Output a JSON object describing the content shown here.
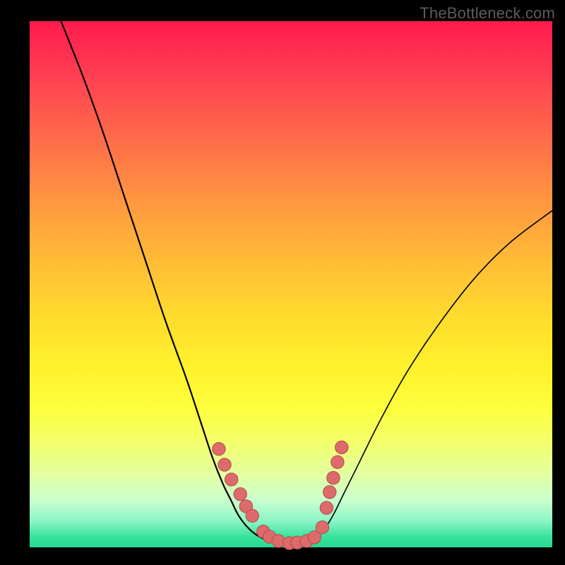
{
  "watermark": "TheBottleneck.com",
  "colors": {
    "frame": "#000000",
    "curve": "#000000",
    "dot_fill": "#dd6b6b",
    "dot_stroke": "#b44a4a",
    "gradient_top": "#ff1a4d",
    "gradient_bottom": "#28d890"
  },
  "chart_data": {
    "type": "line",
    "title": "",
    "xlabel": "",
    "ylabel": "",
    "xlim": [
      0,
      100
    ],
    "ylim": [
      0,
      100
    ],
    "series": [
      {
        "name": "left-curve",
        "x": [
          6,
          10,
          14,
          18,
          22,
          26,
          30,
          33,
          35,
          37,
          38.5,
          40,
          42,
          44,
          46
        ],
        "y": [
          100,
          90,
          79,
          67,
          55,
          43,
          32,
          23,
          17,
          12,
          9,
          6,
          3.5,
          2,
          1.2
        ]
      },
      {
        "name": "valley-floor",
        "x": [
          46,
          48,
          50,
          52,
          54
        ],
        "y": [
          1.2,
          0.8,
          0.7,
          0.9,
          1.4
        ]
      },
      {
        "name": "right-curve",
        "x": [
          54,
          56,
          58,
          60,
          63,
          67,
          72,
          78,
          85,
          92,
          100
        ],
        "y": [
          1.4,
          3,
          6,
          10,
          16,
          24,
          33,
          42,
          51,
          58,
          64
        ]
      }
    ],
    "markers": {
      "name": "highlighted-points",
      "points": [
        {
          "x": 36.2,
          "y": 18.7
        },
        {
          "x": 37.3,
          "y": 15.7
        },
        {
          "x": 38.6,
          "y": 12.9
        },
        {
          "x": 40.3,
          "y": 10.1
        },
        {
          "x": 41.4,
          "y": 7.8
        },
        {
          "x": 42.6,
          "y": 6.0
        },
        {
          "x": 44.7,
          "y": 3.0
        },
        {
          "x": 45.9,
          "y": 2.0
        },
        {
          "x": 47.6,
          "y": 1.2
        },
        {
          "x": 49.7,
          "y": 0.8
        },
        {
          "x": 51.2,
          "y": 0.9
        },
        {
          "x": 53.0,
          "y": 1.2
        },
        {
          "x": 54.5,
          "y": 1.9
        },
        {
          "x": 56.0,
          "y": 3.8
        },
        {
          "x": 56.8,
          "y": 7.5
        },
        {
          "x": 57.4,
          "y": 10.5
        },
        {
          "x": 58.1,
          "y": 13.2
        },
        {
          "x": 58.9,
          "y": 16.2
        },
        {
          "x": 59.7,
          "y": 19.0
        }
      ]
    }
  }
}
